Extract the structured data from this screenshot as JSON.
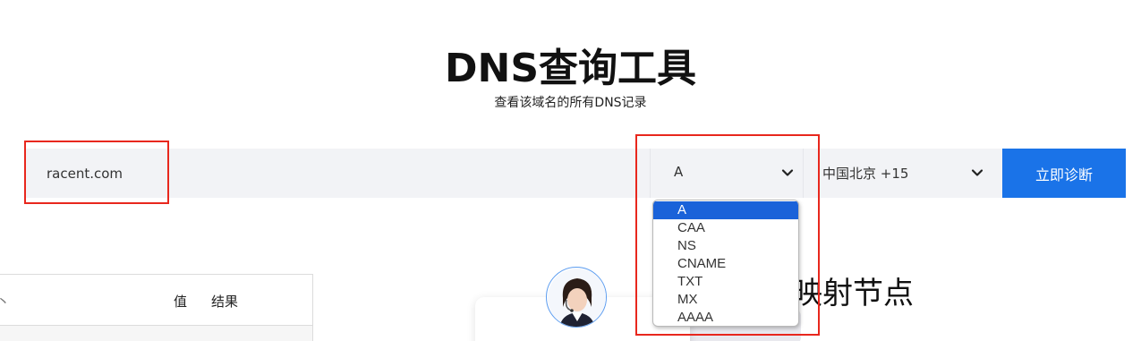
{
  "header": {
    "title": "DNS查询工具",
    "subtitle": "查看该域名的所有DNS记录"
  },
  "search": {
    "domain_value": "racent.com"
  },
  "record_type_select": {
    "selected": "A",
    "options": [
      "A",
      "CAA",
      "NS",
      "CNAME",
      "TXT",
      "MX",
      "AAAA"
    ]
  },
  "region_select": {
    "selected": "中国北京 +15"
  },
  "diagnose_button": {
    "label": "立即诊断"
  },
  "results_table": {
    "col_value": "值",
    "col_result": "结果",
    "partial_col": "丶"
  },
  "section": {
    "heading_partial": "映射节点"
  },
  "colors": {
    "accent": "#1a73e8",
    "highlight_box": "#e8271d",
    "search_bg": "#f2f3f6"
  },
  "icons": {
    "type_select_chevron": "chevron-down-icon",
    "region_select_chevron": "chevron-down-icon",
    "avatar": "support-agent-avatar"
  }
}
